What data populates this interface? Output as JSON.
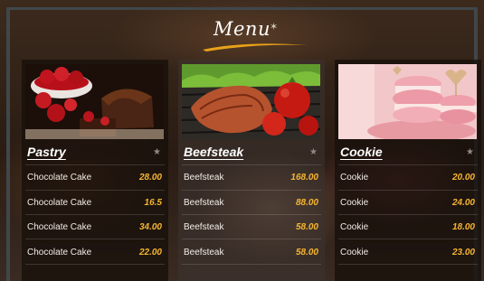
{
  "menu": {
    "title": "Menu"
  },
  "panels": [
    {
      "category": "Pastry",
      "items": [
        {
          "name": "Chocolate Cake",
          "price": "28.00"
        },
        {
          "name": "Chocolate Cake",
          "price": "16.5"
        },
        {
          "name": "Chocolate Cake",
          "price": "34.00"
        },
        {
          "name": "Chocolate Cake",
          "price": "22.00"
        }
      ]
    },
    {
      "category": "Beefsteak",
      "items": [
        {
          "name": "Beefsteak",
          "price": "168.00"
        },
        {
          "name": "Beefsteak",
          "price": "88.00"
        },
        {
          "name": "Beefsteak",
          "price": "58.00"
        },
        {
          "name": "Beefsteak",
          "price": "58.00"
        }
      ]
    },
    {
      "category": "Cookie",
      "items": [
        {
          "name": "Cookie",
          "price": "20.00"
        },
        {
          "name": "Cookie",
          "price": "24.00"
        },
        {
          "name": "Cookie",
          "price": "18.00"
        },
        {
          "name": "Cookie",
          "price": "23.00"
        }
      ]
    }
  ],
  "colors": {
    "price": "#f5b431",
    "swoosh": "#e8a21a",
    "panel": "#18100b"
  },
  "icons": {
    "category_marker": "star-icon",
    "title_decoration": "star-icon"
  }
}
